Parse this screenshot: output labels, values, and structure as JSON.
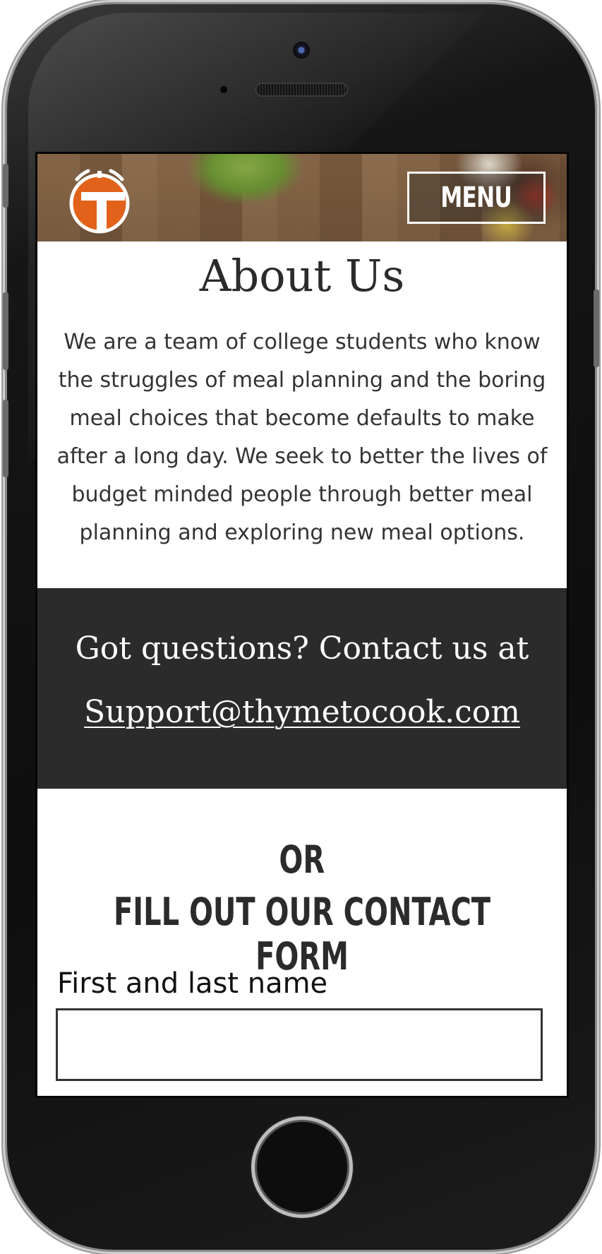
{
  "header": {
    "logo_name": "thyme-to-cook-logo",
    "menu_label": "MENU"
  },
  "about": {
    "title": "About Us",
    "body": "We are a team of college students who know the struggles of meal planning and the boring meal choices that become defaults to make after a long day. We seek to better the lives of budget minded people through better meal planning and exploring new meal options."
  },
  "contact": {
    "line": "Got questions? Contact us at",
    "email": "Support@thymetocook.com"
  },
  "form": {
    "or_label": "OR",
    "heading": "FILL OUT OUR CONTACT FORM",
    "name_label": "First and last name",
    "name_value": ""
  },
  "colors": {
    "accent": "#e2621b",
    "dark_band": "#2b2b2b",
    "text": "#333333"
  }
}
